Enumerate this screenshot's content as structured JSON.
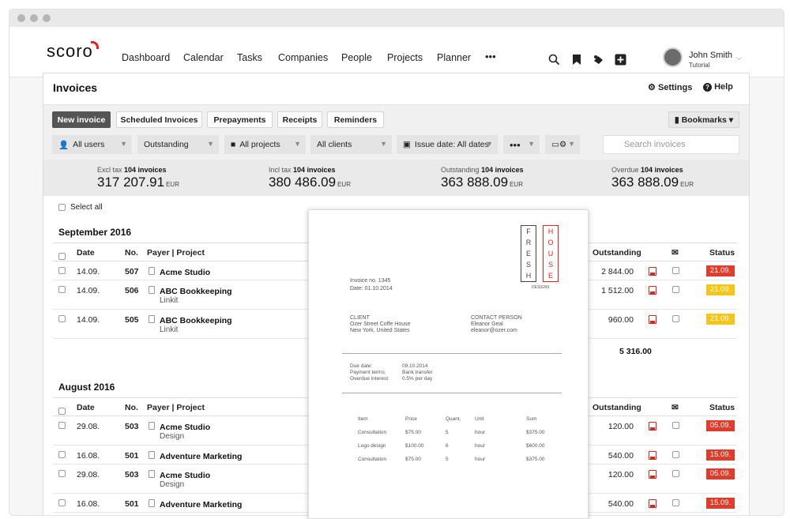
{
  "nav": {
    "logo": "scoro",
    "items": [
      "Dashboard",
      "Calendar",
      "Tasks",
      "Companies",
      "People",
      "Projects",
      "Planner",
      "•••"
    ],
    "user_name": "John Smith",
    "user_sub": "Tutorial"
  },
  "page": {
    "title": "Invoices",
    "settings": "Settings",
    "help": "Help",
    "bookmarks": "Bookmarks ▾"
  },
  "tabs": [
    "New invoice",
    "Scheduled Invoices",
    "Prepayments",
    "Receipts",
    "Reminders"
  ],
  "filters": {
    "users": "All users",
    "status": "Outstanding",
    "projects": "All projects",
    "clients": "All clients",
    "issue_date": "Issue date: All dates",
    "more": "•••",
    "search_placeholder": "Search invoices"
  },
  "totals": [
    {
      "caption": "Excl tax",
      "count": "104 invoices",
      "value": "317 207.91",
      "unit": "EUR"
    },
    {
      "caption": "Incl tax",
      "count": "104 invoices",
      "value": "380 486.09",
      "unit": "EUR"
    },
    {
      "caption": "Outstanding",
      "count": "104 invoices",
      "value": "363 888.09",
      "unit": "EUR"
    },
    {
      "caption": "Overdue",
      "count": "104 invoices",
      "value": "363 888.09",
      "unit": "EUR"
    }
  ],
  "select_all": "Select all",
  "columns": {
    "date": "Date",
    "no": "No.",
    "payer": "Payer | Project",
    "outstanding": "Outstanding",
    "status": "Status"
  },
  "sections": [
    {
      "title": "September 2016",
      "rows": [
        {
          "date": "14.09.",
          "no": "507",
          "payer": "Acme Studio",
          "project": "",
          "outstanding": "2 844.00",
          "status": "21.09.",
          "status_color": "#e03b2b"
        },
        {
          "date": "14.09.",
          "no": "506",
          "payer": "ABC Bookkeeping",
          "project": "Linkit",
          "outstanding": "1 512.00",
          "status": "21.09.",
          "status_color": "#f5c518"
        },
        {
          "date": "14.09.",
          "no": "505",
          "payer": "ABC Bookkeeping",
          "project": "Linkit",
          "outstanding": "960.00",
          "status": "21.09.",
          "status_color": "#f5c518"
        }
      ],
      "total": "5 316.00"
    },
    {
      "title": "August 2016",
      "rows": [
        {
          "date": "29.08.",
          "no": "503",
          "payer": "Acme Studio",
          "project": "Design",
          "outstanding": "120.00",
          "status": "05.09.",
          "status_color": "#e03b2b"
        },
        {
          "date": "16.08.",
          "no": "501",
          "payer": "Adventure Marketing",
          "project": "",
          "outstanding": "540.00",
          "status": "15.09.",
          "status_color": "#e03b2b"
        },
        {
          "date": "29.08.",
          "no": "503",
          "payer": "Acme Studio",
          "project": "Design",
          "outstanding": "120.00",
          "status": "05.09.",
          "status_color": "#e03b2b"
        },
        {
          "date": "16.08.",
          "no": "501",
          "payer": "Adventure Marketing",
          "project": "",
          "outstanding": "540.00",
          "status": "15.09.",
          "status_color": "#e03b2b"
        }
      ]
    }
  ],
  "preview": {
    "brand_left": [
      "F",
      "R",
      "E",
      "S",
      "H"
    ],
    "brand_right": [
      "H",
      "O",
      "U",
      "S",
      "E"
    ],
    "brand_sub": "DESIGNS",
    "invoice_no": "Invoice no. 1345",
    "date": "Date:  01.10.2014",
    "client_label": "CLIENT",
    "client_name": "Ozer Street Coffe House",
    "client_city": "New York, United States",
    "contact_label": "CONTACT PERSON",
    "contact_name": "Eleanor Geal",
    "contact_email": "eleanor@ozer.com",
    "terms_labels": [
      "Due date:",
      "Payment terms:",
      "Overdue interest:"
    ],
    "terms_values": [
      "09.10.2014",
      "Bank transfer",
      "0.5% per day"
    ],
    "item_headers": [
      "Item",
      "Price",
      "Quant.",
      "Unit",
      "Sum"
    ],
    "items": [
      [
        "Consultation",
        "$75.00",
        "5",
        "hour",
        "$375.00"
      ],
      [
        "Logo design",
        "$100.00",
        "6",
        "hour",
        "$600.00"
      ],
      [
        "Consultation",
        "$75.00",
        "5",
        "hour",
        "$375.00"
      ]
    ]
  }
}
